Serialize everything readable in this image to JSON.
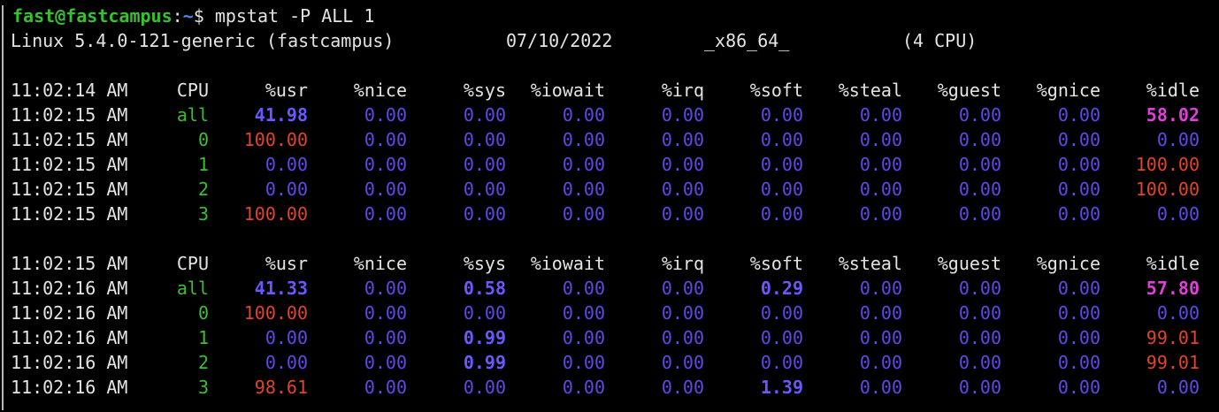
{
  "terminal": {
    "prompt": {
      "user_host": "fast@fastcampus",
      "colon": ":",
      "path": "~",
      "symbol": "$",
      "command": "mpstat -P ALL 1"
    },
    "sysinfo": {
      "kernel": "Linux 5.4.0-121-generic (fastcampus)",
      "date": "07/10/2022",
      "arch": "_x86_64_",
      "cpus": "(4 CPU)"
    },
    "columns": [
      "CPU",
      "%usr",
      "%nice",
      "%sys",
      "%iowait",
      "%irq",
      "%soft",
      "%steal",
      "%guest",
      "%gnice",
      "%idle"
    ],
    "blocks": [
      {
        "header_time": "11:02:14 AM",
        "rows": [
          {
            "time": "11:02:15 AM",
            "cpu": "all",
            "usr": "41.98",
            "nice": "0.00",
            "sys": "0.00",
            "iowait": "0.00",
            "irq": "0.00",
            "soft": "0.00",
            "steal": "0.00",
            "guest": "0.00",
            "gnice": "0.00",
            "idle": "58.02"
          },
          {
            "time": "11:02:15 AM",
            "cpu": "0",
            "usr": "100.00",
            "nice": "0.00",
            "sys": "0.00",
            "iowait": "0.00",
            "irq": "0.00",
            "soft": "0.00",
            "steal": "0.00",
            "guest": "0.00",
            "gnice": "0.00",
            "idle": "0.00"
          },
          {
            "time": "11:02:15 AM",
            "cpu": "1",
            "usr": "0.00",
            "nice": "0.00",
            "sys": "0.00",
            "iowait": "0.00",
            "irq": "0.00",
            "soft": "0.00",
            "steal": "0.00",
            "guest": "0.00",
            "gnice": "0.00",
            "idle": "100.00"
          },
          {
            "time": "11:02:15 AM",
            "cpu": "2",
            "usr": "0.00",
            "nice": "0.00",
            "sys": "0.00",
            "iowait": "0.00",
            "irq": "0.00",
            "soft": "0.00",
            "steal": "0.00",
            "guest": "0.00",
            "gnice": "0.00",
            "idle": "100.00"
          },
          {
            "time": "11:02:15 AM",
            "cpu": "3",
            "usr": "100.00",
            "nice": "0.00",
            "sys": "0.00",
            "iowait": "0.00",
            "irq": "0.00",
            "soft": "0.00",
            "steal": "0.00",
            "guest": "0.00",
            "gnice": "0.00",
            "idle": "0.00"
          }
        ]
      },
      {
        "header_time": "11:02:15 AM",
        "rows": [
          {
            "time": "11:02:16 AM",
            "cpu": "all",
            "usr": "41.33",
            "nice": "0.00",
            "sys": "0.58",
            "iowait": "0.00",
            "irq": "0.00",
            "soft": "0.29",
            "steal": "0.00",
            "guest": "0.00",
            "gnice": "0.00",
            "idle": "57.80"
          },
          {
            "time": "11:02:16 AM",
            "cpu": "0",
            "usr": "100.00",
            "nice": "0.00",
            "sys": "0.00",
            "iowait": "0.00",
            "irq": "0.00",
            "soft": "0.00",
            "steal": "0.00",
            "guest": "0.00",
            "gnice": "0.00",
            "idle": "0.00"
          },
          {
            "time": "11:02:16 AM",
            "cpu": "1",
            "usr": "0.00",
            "nice": "0.00",
            "sys": "0.99",
            "iowait": "0.00",
            "irq": "0.00",
            "soft": "0.00",
            "steal": "0.00",
            "guest": "0.00",
            "gnice": "0.00",
            "idle": "99.01"
          },
          {
            "time": "11:02:16 AM",
            "cpu": "2",
            "usr": "0.00",
            "nice": "0.00",
            "sys": "0.99",
            "iowait": "0.00",
            "irq": "0.00",
            "soft": "0.00",
            "steal": "0.00",
            "guest": "0.00",
            "gnice": "0.00",
            "idle": "99.01"
          },
          {
            "time": "11:02:16 AM",
            "cpu": "3",
            "usr": "98.61",
            "nice": "0.00",
            "sys": "0.00",
            "iowait": "0.00",
            "irq": "0.00",
            "soft": "1.39",
            "steal": "0.00",
            "guest": "0.00",
            "gnice": "0.00",
            "idle": "0.00"
          }
        ]
      }
    ]
  },
  "colors": {
    "background": "#000000",
    "text": "#e4e4e4",
    "prompt_user": "#39c02f",
    "prompt_path": "#3f8ef2",
    "cpu_id": "#39c02f",
    "low_value": "#5b4be8",
    "high_value": "#e0442c",
    "idle_all": "#e03fd8"
  }
}
